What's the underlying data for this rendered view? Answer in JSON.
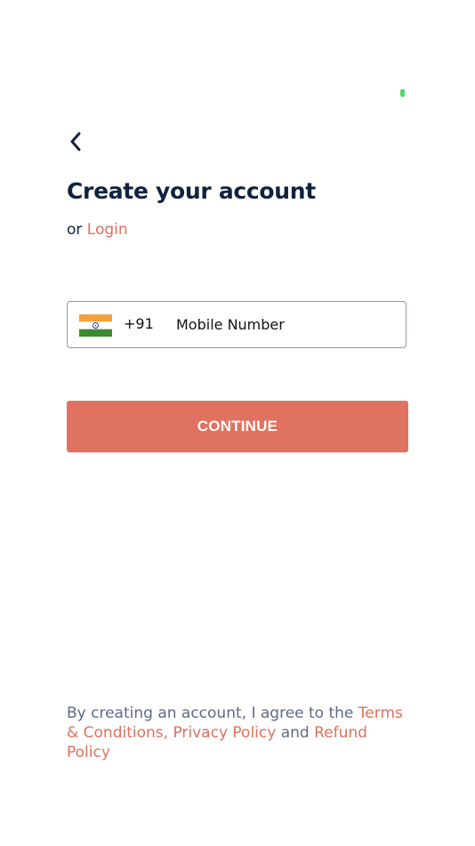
{
  "status": {
    "indicator_color": "#4cd964"
  },
  "header": {
    "back_icon": "chevron-left-icon",
    "title": "Create your account",
    "login_prefix": "or",
    "login_link": "Login"
  },
  "phone": {
    "country_flag": "india-flag-icon",
    "country_code": "+91",
    "placeholder": "Mobile Number",
    "value": ""
  },
  "actions": {
    "continue_label": "CONTINUE"
  },
  "legal": {
    "prefix": "By creating an account, I agree to the",
    "terms_link": "Terms & Conditions,",
    "privacy_link": "Privacy Policy",
    "conjunction": "and",
    "refund_link": "Refund Policy"
  },
  "colors": {
    "accent": "#df7360",
    "link": "#e0705d",
    "heading": "#0f2341",
    "muted_text": "#5e6b85",
    "field_border": "#8a9aa8"
  }
}
